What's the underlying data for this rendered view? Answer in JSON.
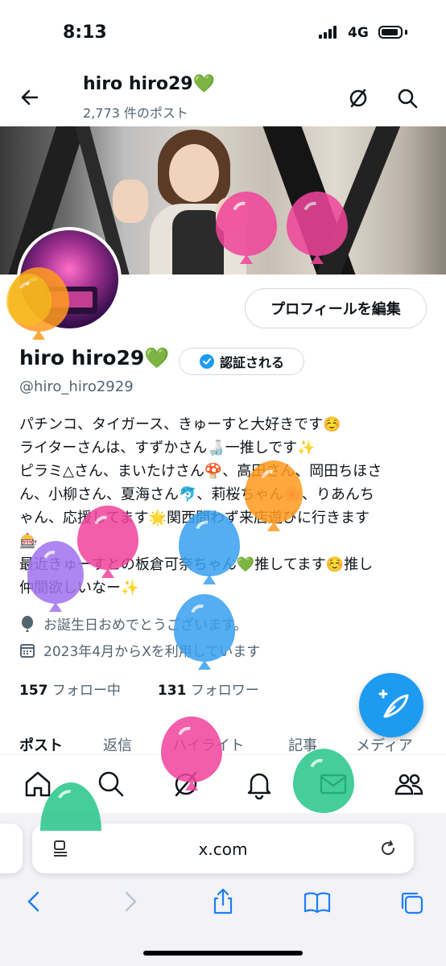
{
  "status_bar": {
    "time": "8:13",
    "network": "4G"
  },
  "header": {
    "name": "hiro hiro29💚",
    "post_count": "2,773 件のポスト"
  },
  "profile": {
    "edit_button": "プロフィールを編集",
    "name": "hiro hiro29💚",
    "verified_label": "認証される",
    "handle": "@hiro_hiro2929",
    "bio_lines": [
      "パチンコ、タイガース、きゅーすと大好きです☺️",
      "ライターさんは、すずかさん🍶一推しです✨",
      "ピラミ△さん、まいたけさん🍄、高田さん、岡田ちほさ",
      "ん、小柳さん、夏海さん🐬、莉桜ちゃん🌸、りあんち",
      "ゃん、応援してます🌟関西問わず来店遊びに行きます",
      "🎰",
      "最近きゅーすとの板倉可奈ちゃん💚推してます☺️推し",
      "仲間欲しいなー✨"
    ],
    "birthday": "お誕生日おめでとうございます。",
    "joined": "2023年4月からXを利用しています",
    "following_count": "157",
    "following_label": "フォロー中",
    "followers_count": "131",
    "followers_label": "フォロワー"
  },
  "tabs": [
    "ポスト",
    "返信",
    "ハイライト",
    "記事",
    "メディア"
  ],
  "browser": {
    "url": "x.com"
  },
  "colors": {
    "accent": "#1d9bf0",
    "text": "#0f1419",
    "muted": "#536471",
    "balloon_pink": "#f0449b",
    "balloon_orange": "#ff9a1f",
    "balloon_blue": "#3aa0f0",
    "balloon_purple": "#a173f0",
    "balloon_green": "#27c68a",
    "balloon_yellow": "#f5c21c"
  }
}
